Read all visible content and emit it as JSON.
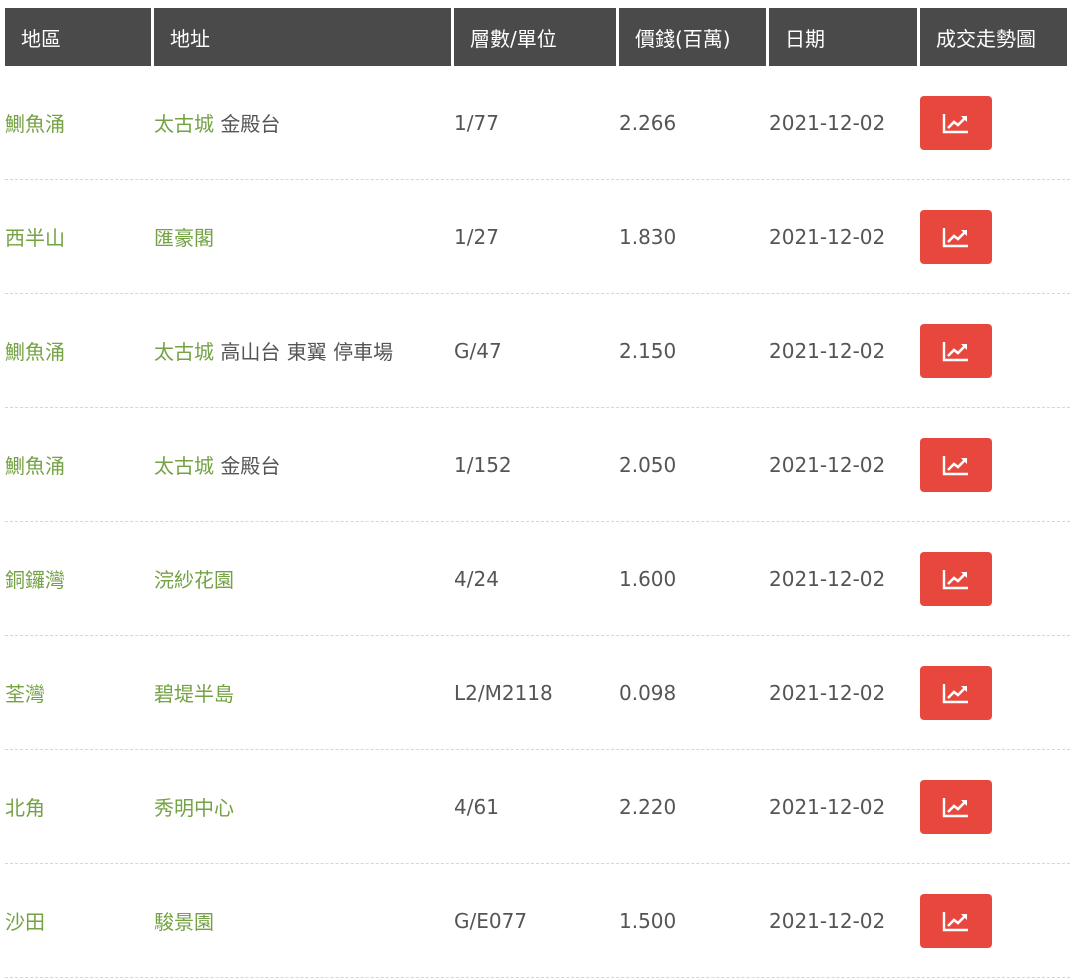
{
  "header": {
    "district": "地區",
    "address": "地址",
    "floor_unit": "層數/單位",
    "price": "價錢(百萬)",
    "date": "日期",
    "trend": "成交走勢圖"
  },
  "rows": [
    {
      "district": "鰂魚涌",
      "estate": "太古城",
      "address_rest": " 金殿台",
      "floor_unit": "1/77",
      "price": "2.266",
      "date": "2021-12-02"
    },
    {
      "district": "西半山",
      "estate": "匯豪閣",
      "address_rest": "",
      "floor_unit": "1/27",
      "price": "1.830",
      "date": "2021-12-02"
    },
    {
      "district": "鰂魚涌",
      "estate": "太古城",
      "address_rest": " 高山台 東翼 停車場",
      "floor_unit": "G/47",
      "price": "2.150",
      "date": "2021-12-02"
    },
    {
      "district": "鰂魚涌",
      "estate": "太古城",
      "address_rest": " 金殿台",
      "floor_unit": "1/152",
      "price": "2.050",
      "date": "2021-12-02"
    },
    {
      "district": "銅鑼灣",
      "estate": "浣紗花園",
      "address_rest": "",
      "floor_unit": "4/24",
      "price": "1.600",
      "date": "2021-12-02"
    },
    {
      "district": "荃灣",
      "estate": "碧堤半島",
      "address_rest": "",
      "floor_unit": "L2/M2118",
      "price": "0.098",
      "date": "2021-12-02"
    },
    {
      "district": "北角",
      "estate": "秀明中心",
      "address_rest": "",
      "floor_unit": "4/61",
      "price": "2.220",
      "date": "2021-12-02"
    },
    {
      "district": "沙田",
      "estate": "駿景園",
      "address_rest": "",
      "floor_unit": "G/E077",
      "price": "1.500",
      "date": "2021-12-02"
    }
  ],
  "colors": {
    "header_bg": "#4a4a4a",
    "link_green": "#74a244",
    "button_red": "#e8473d"
  },
  "icons": {
    "trend_button": "line-chart-icon"
  }
}
